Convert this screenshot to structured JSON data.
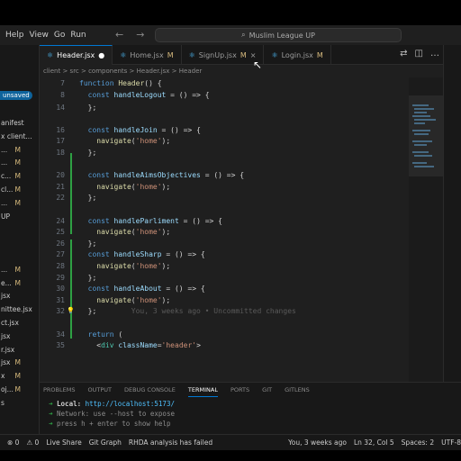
{
  "menu": [
    "Help",
    "View",
    "Go",
    "Run"
  ],
  "search": {
    "text": "Muslim League UP"
  },
  "tabs": [
    {
      "label": "Header.jsx",
      "dot": "●",
      "active": true,
      "icon": "react-icon"
    },
    {
      "label": "Home.jsx",
      "mod": "M",
      "icon": "react-icon"
    },
    {
      "label": "SignUp.jsx",
      "mod": "M",
      "icon": "react-icon",
      "close": "×"
    },
    {
      "label": "Login.jsx",
      "mod": "M",
      "icon": "react-icon"
    }
  ],
  "breadcrumb": "client > src > components > Header.jsx > Header",
  "sidebar": {
    "unsaved": "unsaved",
    "rows": [
      {
        "t": "anifest",
        "m": ""
      },
      {
        "t": "x client...",
        "m": ""
      },
      {
        "t": "...",
        "m": "M"
      },
      {
        "t": "...",
        "m": "M"
      },
      {
        "t": "c...",
        "m": "M"
      },
      {
        "t": "cl...",
        "m": "M"
      },
      {
        "t": "...",
        "m": "M"
      },
      {
        "t": "UP",
        "m": ""
      },
      {
        "t": "",
        "m": ""
      },
      {
        "t": "",
        "m": ""
      },
      {
        "t": "",
        "m": ""
      },
      {
        "t": "...",
        "m": "M"
      },
      {
        "t": "e...",
        "m": "M"
      },
      {
        "t": "jsx",
        "m": ""
      },
      {
        "t": "nittee.jsx",
        "m": ""
      },
      {
        "t": "ct.jsx",
        "m": ""
      },
      {
        "t": "jsx",
        "m": ""
      },
      {
        "t": "r.jsx",
        "m": ""
      },
      {
        "t": "jsx",
        "m": "M"
      },
      {
        "t": "x",
        "m": "M"
      },
      {
        "t": "oj...",
        "m": "M"
      },
      {
        "t": "s",
        "m": ""
      },
      {
        "t": "",
        "m": ""
      },
      {
        "t": "",
        "m": ""
      },
      {
        "t": "",
        "m": ""
      },
      {
        "t": "",
        "m": "M"
      }
    ]
  },
  "code": [
    {
      "n": "7",
      "parts": [
        [
          "kw",
          "function "
        ],
        [
          "fn",
          "Header"
        ],
        [
          "op",
          "() {"
        ]
      ]
    },
    {
      "n": "8",
      "parts": [
        [
          "op",
          "  "
        ],
        [
          "kw",
          "const "
        ],
        [
          "attr",
          "handleLogout"
        ],
        [
          "op",
          " = () => {"
        ]
      ]
    },
    {
      "n": "14",
      "parts": [
        [
          "op",
          "  };"
        ]
      ]
    },
    {
      "n": "",
      "parts": []
    },
    {
      "n": "16",
      "parts": [
        [
          "op",
          "  "
        ],
        [
          "kw",
          "const "
        ],
        [
          "attr",
          "handleJoin"
        ],
        [
          "op",
          " = () => {"
        ]
      ]
    },
    {
      "n": "17",
      "parts": [
        [
          "op",
          "    "
        ],
        [
          "fn",
          "navigate"
        ],
        [
          "op",
          "("
        ],
        [
          "str",
          "'home'"
        ],
        [
          "op",
          ");"
        ]
      ]
    },
    {
      "n": "18",
      "parts": [
        [
          "op",
          "  };"
        ]
      ]
    },
    {
      "n": "",
      "parts": []
    },
    {
      "n": "20",
      "parts": [
        [
          "op",
          "  "
        ],
        [
          "kw",
          "const "
        ],
        [
          "attr",
          "handleAimsObjectives"
        ],
        [
          "op",
          " = () => {"
        ]
      ]
    },
    {
      "n": "21",
      "parts": [
        [
          "op",
          "    "
        ],
        [
          "fn",
          "navigate"
        ],
        [
          "op",
          "("
        ],
        [
          "str",
          "'home'"
        ],
        [
          "op",
          ");"
        ]
      ]
    },
    {
      "n": "22",
      "parts": [
        [
          "op",
          "  };"
        ]
      ]
    },
    {
      "n": "",
      "parts": []
    },
    {
      "n": "24",
      "parts": [
        [
          "op",
          "  "
        ],
        [
          "kw",
          "const "
        ],
        [
          "attr",
          "handleParliment"
        ],
        [
          "op",
          " = () => {"
        ]
      ]
    },
    {
      "n": "25",
      "parts": [
        [
          "op",
          "    "
        ],
        [
          "fn",
          "navigate"
        ],
        [
          "op",
          "("
        ],
        [
          "str",
          "'home'"
        ],
        [
          "op",
          ");"
        ]
      ]
    },
    {
      "n": "26",
      "parts": [
        [
          "op",
          "  };"
        ]
      ]
    },
    {
      "n": "27",
      "parts": [
        [
          "op",
          "  "
        ],
        [
          "kw",
          "const "
        ],
        [
          "attr",
          "handleSharp"
        ],
        [
          "op",
          " = () => {"
        ]
      ]
    },
    {
      "n": "28",
      "parts": [
        [
          "op",
          "    "
        ],
        [
          "fn",
          "navigate"
        ],
        [
          "op",
          "("
        ],
        [
          "str",
          "'home'"
        ],
        [
          "op",
          ");"
        ]
      ]
    },
    {
      "n": "29",
      "parts": [
        [
          "op",
          "  };"
        ]
      ]
    },
    {
      "n": "30",
      "parts": [
        [
          "op",
          "  "
        ],
        [
          "kw",
          "const "
        ],
        [
          "attr",
          "handleAbout"
        ],
        [
          "op",
          " = () => {"
        ]
      ]
    },
    {
      "n": "31",
      "parts": [
        [
          "op",
          "    "
        ],
        [
          "fn",
          "navigate"
        ],
        [
          "op",
          "("
        ],
        [
          "str",
          "'home'"
        ],
        [
          "op",
          ");"
        ]
      ]
    },
    {
      "n": "32",
      "parts": [
        [
          "op",
          "  };"
        ],
        [
          "ghost",
          "        You, 3 weeks ago • Uncommitted changes"
        ]
      ]
    },
    {
      "n": "",
      "parts": []
    },
    {
      "n": "34",
      "parts": [
        [
          "op",
          "  "
        ],
        [
          "kw",
          "return "
        ],
        [
          "op",
          "("
        ]
      ]
    },
    {
      "n": "35",
      "parts": [
        [
          "op",
          "    <"
        ],
        [
          "tag",
          "div "
        ],
        [
          "attr",
          "className"
        ],
        [
          "op",
          "="
        ],
        [
          "str",
          "'header'"
        ],
        [
          "op",
          ">"
        ]
      ]
    }
  ],
  "panel": {
    "tabs": [
      "PROBLEMS",
      "OUTPUT",
      "DEBUG CONSOLE",
      "TERMINAL",
      "PORTS",
      "GIT",
      "GITLENS"
    ],
    "active": "TERMINAL",
    "local_label": "Local:",
    "local_url": "http://localhost:5173/",
    "network": "Network: use --host to expose",
    "help": "press h + enter to show help"
  },
  "status": {
    "left": [
      "⊗ 0",
      "⚠ 0",
      "Live Share",
      "Git Graph",
      "RHDA analysis has failed"
    ],
    "right": [
      "You, 3 weeks ago",
      "Ln 32, Col 5",
      "Spaces: 2",
      "UTF-8"
    ]
  }
}
